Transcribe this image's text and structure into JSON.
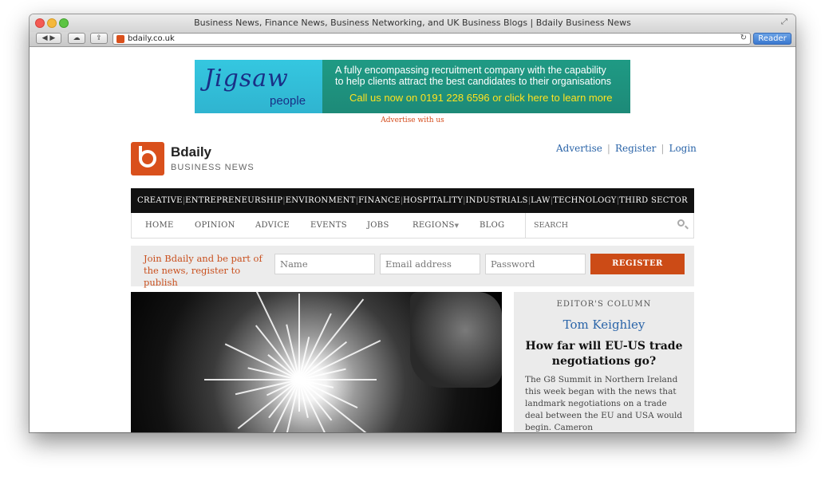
{
  "window": {
    "title": "Business News, Finance News, Business Networking, and UK Business Blogs | Bdaily Business News"
  },
  "toolbar": {
    "url": "bdaily.co.uk",
    "reader_label": "Reader"
  },
  "ad": {
    "logo_word": "Jigsaw",
    "logo_sub": "people",
    "line1": "A fully encompassing recruitment company with the capability",
    "line2": "to help clients attract the best candidates to their organisations",
    "cta": "Call us now on 0191 228 6596  or click here to learn more",
    "advertise_link": "Advertise with us"
  },
  "brand": {
    "name": "Bdaily",
    "tagline": "BUSINESS NEWS"
  },
  "top_links": [
    "Advertise",
    "Register",
    "Login"
  ],
  "categories": [
    "CREATIVE",
    "ENTREPRENEURSHIP",
    "ENVIRONMENT",
    "FINANCE",
    "HOSPITALITY",
    "INDUSTRIALS",
    "LAW",
    "TECHNOLOGY",
    "THIRD SECTOR"
  ],
  "subnav": {
    "items": [
      "HOME",
      "OPINION",
      "ADVICE",
      "EVENTS",
      "JOBS",
      "REGIONS",
      "BLOG"
    ],
    "search": "SEARCH"
  },
  "join": {
    "text": "Join Bdaily and be part of the news, register to publish",
    "name_placeholder": "Name",
    "email_placeholder": "Email address",
    "password_placeholder": "Password",
    "button": "REGISTER"
  },
  "editor": {
    "label": "EDITOR'S COLUMN",
    "author": "Tom Keighley",
    "title": "How far will EU-US trade negotiations go?",
    "excerpt": "The G8 Summit in Northern Ireland this week began with the news that landmark negotiations on a trade deal between the EU and USA would begin. Cameron"
  },
  "colors": {
    "accent": "#d9501c",
    "link": "#2a64a8",
    "nav_bg": "#111111"
  }
}
